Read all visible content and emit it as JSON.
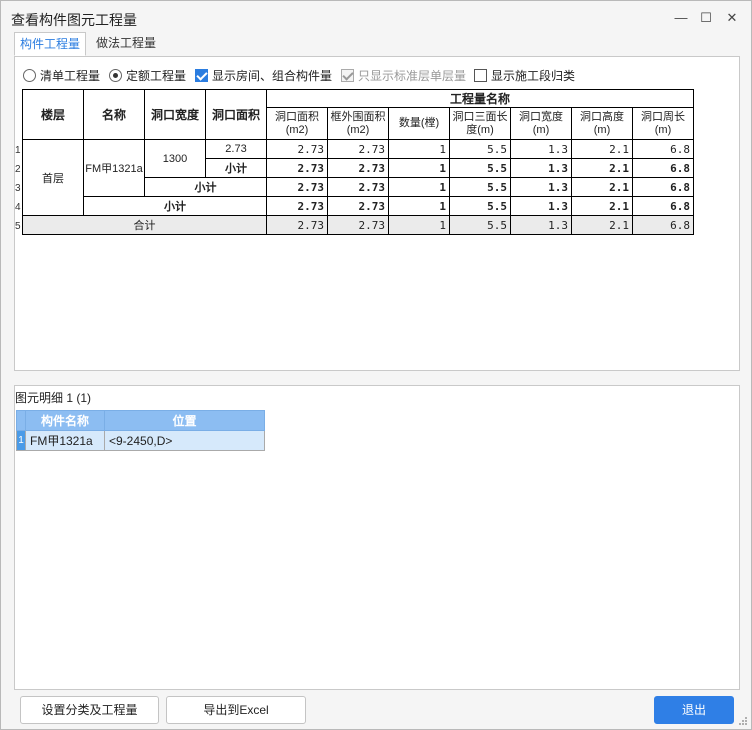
{
  "window": {
    "title": "查看构件图元工程量",
    "minimize": "—",
    "maximize": "☐",
    "close": "✕"
  },
  "tabs": [
    {
      "label": "构件工程量",
      "active": true
    },
    {
      "label": "做法工程量",
      "active": false
    }
  ],
  "options": {
    "radio_list": "清单工程量",
    "radio_quota": "定额工程量",
    "check_rooms": "显示房间、组合构件量",
    "check_standard": "只显示标准层单层量",
    "check_sections": "显示施工段归类"
  },
  "grid": {
    "headers": {
      "floor": "楼层",
      "name": "名称",
      "opening_width": "洞口宽度",
      "opening_area": "洞口面积",
      "group": "工程量名称",
      "cols": [
        "洞口面积(m2)",
        "框外围面积(m2)",
        "数量(樘)",
        "洞口三面长度(m)",
        "洞口宽度(m)",
        "洞口高度(m)",
        "洞口周长(m)"
      ]
    },
    "row_numbers": [
      "1",
      "2",
      "3",
      "4",
      "5"
    ],
    "floor": "首层",
    "name": "FM甲1321a",
    "width": "1300",
    "area": "2.73",
    "subtotal_label": "小计",
    "total_label": "合计",
    "rows": [
      [
        "2.73",
        "2.73",
        "1",
        "5.5",
        "1.3",
        "2.1",
        "6.8"
      ],
      [
        "2.73",
        "2.73",
        "1",
        "5.5",
        "1.3",
        "2.1",
        "6.8"
      ],
      [
        "2.73",
        "2.73",
        "1",
        "5.5",
        "1.3",
        "2.1",
        "6.8"
      ],
      [
        "2.73",
        "2.73",
        "1",
        "5.5",
        "1.3",
        "2.1",
        "6.8"
      ],
      [
        "2.73",
        "2.73",
        "1",
        "5.5",
        "1.3",
        "2.1",
        "6.8"
      ]
    ]
  },
  "detail": {
    "title": "图元明细  1 (1)",
    "headers": [
      "构件名称",
      "位置"
    ],
    "row_number": "1",
    "row": [
      "FM甲1321a",
      "<9-2450,D>"
    ]
  },
  "buttons": {
    "settings": "设置分类及工程量",
    "export": "导出到Excel",
    "exit": "退出"
  }
}
